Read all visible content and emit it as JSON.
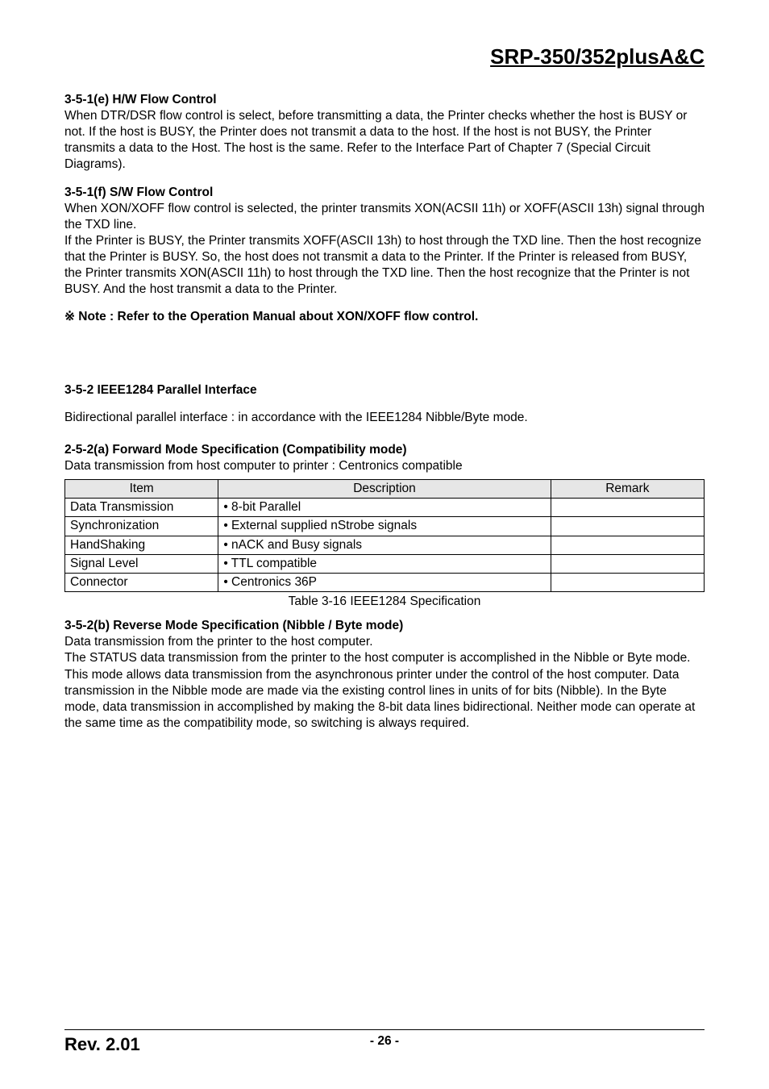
{
  "header": {
    "product_title": "SRP-350/352plusA&C"
  },
  "sec_e": {
    "title": "3-5-1(e) H/W Flow Control",
    "body": "When DTR/DSR flow control is select, before transmitting a data, the Printer checks whether the host is BUSY or not. If the host is BUSY, the Printer does not transmit a data to the host. If the host is not BUSY, the Printer transmits a data to the Host. The host is the same. Refer to the Interface Part of Chapter 7 (Special Circuit Diagrams)."
  },
  "sec_f": {
    "title": "3-5-1(f) S/W Flow Control",
    "body1": "When XON/XOFF flow control is selected, the printer transmits XON(ACSII 11h) or XOFF(ASCII 13h) signal through the TXD line.",
    "body2": "If the Printer is BUSY, the Printer transmits XOFF(ASCII 13h) to host through the TXD line. Then the host recognize that the Printer is BUSY. So, the host does not transmit a data to the Printer. If the Printer is released from BUSY, the Printer transmits XON(ASCII 11h) to host through the TXD line. Then the host recognize that the Printer is not BUSY. And the host transmit a data to the Printer."
  },
  "note": "※ Note : Refer to the Operation Manual about XON/XOFF flow control.",
  "sec_352": {
    "title": "3-5-2 IEEE1284 Parallel Interface",
    "body": "Bidirectional parallel interface : in accordance with the IEEE1284 Nibble/Byte mode."
  },
  "sec_252a": {
    "title": "2-5-2(a) Forward Mode Specification (Compatibility mode)",
    "body": "Data transmission from host computer to printer : Centronics compatible"
  },
  "table": {
    "headers": {
      "item": "Item",
      "desc": "Description",
      "remark": "Remark"
    },
    "rows": [
      {
        "item": "Data Transmission",
        "desc": "• 8-bit Parallel",
        "remark": ""
      },
      {
        "item": "Synchronization",
        "desc": "• External supplied nStrobe signals",
        "remark": ""
      },
      {
        "item": "HandShaking",
        "desc": "• nACK and Busy signals",
        "remark": ""
      },
      {
        "item": "Signal Level",
        "desc": "• TTL compatible",
        "remark": ""
      },
      {
        "item": "Connector",
        "desc": "• Centronics 36P",
        "remark": ""
      }
    ],
    "caption": "Table 3-16 IEEE1284 Specification"
  },
  "sec_352b": {
    "title": "3-5-2(b) Reverse Mode Specification (Nibble / Byte mode)",
    "body1": "Data transmission from the printer to the host computer.",
    "body2": "The STATUS data transmission from the printer to the host computer is accomplished in the Nibble or Byte mode. This mode allows data transmission from the asynchronous printer under the control of the host computer. Data transmission in the Nibble mode are made via the existing control lines in units of for bits (Nibble). In the Byte mode, data transmission in accomplished by making the 8-bit data lines bidirectional. Neither mode can operate at the same time as the compatibility mode, so switching is always required."
  },
  "footer": {
    "rev": "Rev. 2.01",
    "page": "- 26 -"
  }
}
